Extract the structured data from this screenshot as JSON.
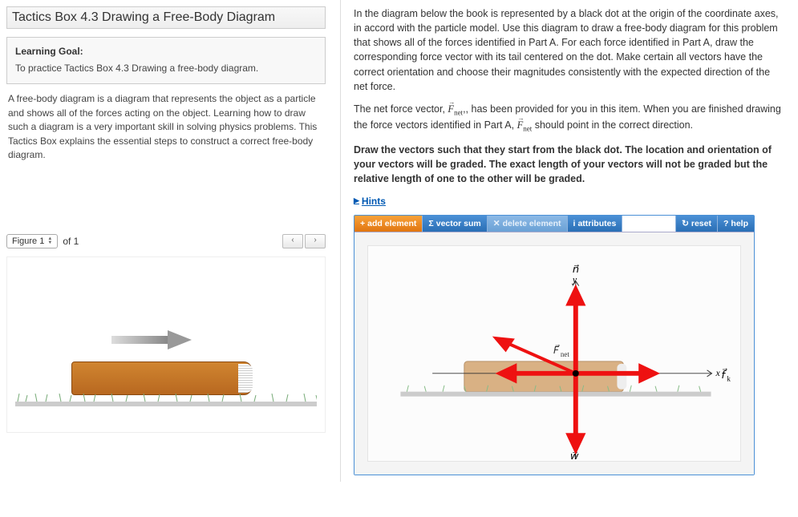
{
  "left": {
    "title": "Tactics Box 4.3 Drawing a Free-Body Diagram",
    "goal_label": "Learning Goal:",
    "goal_text": "To practice Tactics Box 4.3 Drawing a free-body diagram.",
    "desc": "A free-body diagram is a diagram that represents the object as a particle and shows all of the forces acting on the object. Learning how to draw such a diagram is a very important skill in solving physics problems. This Tactics Box explains the essential steps to construct a correct free-body diagram.",
    "figure_label": "Figure 1",
    "figure_total": "of 1"
  },
  "right": {
    "p1": "In the diagram below the book is represented by a black dot at the origin of the coordinate axes, in accord with the particle model. Use this diagram to draw a free-body diagram for this problem that shows all of the forces identified in Part A. For each force identified in Part A, draw the corresponding force vector with its tail centered on the dot. Make certain all vectors have the correct orientation and choose their magnitudes consistently with the expected direction of the net force.",
    "p2a": "The net force vector, ",
    "p2b": ", has been provided for you in this item. When you are finished drawing the force vectors identified in Part A, ",
    "p2c": " should point in the correct direction.",
    "p3": "Draw the vectors such that they start from the black dot. The location and orientation of your vectors will be graded. The exact length of your vectors will not be graded but the relative length of one to the other will be graded.",
    "hints": "Hints",
    "fnet_label": "F",
    "fnet_sub": "net"
  },
  "toolbar": {
    "add": "add element",
    "sum": "vector sum",
    "del": "delete element",
    "attr": "attributes",
    "reset": "reset",
    "help": "help"
  },
  "axis_labels": {
    "y": "n",
    "y2": "y",
    "x": "x",
    "fk": "f",
    "fk_sub": "k",
    "fnet": "F",
    "fnet_sub": "net",
    "w": "w"
  },
  "icons": {
    "plus": "+",
    "sigma": "Σ",
    "x": "✕",
    "info": "i",
    "refresh": "↻",
    "q": "?",
    "tri": "▶",
    "lt": "‹",
    "gt": "›",
    "up": "▲",
    "dn": "▼"
  }
}
